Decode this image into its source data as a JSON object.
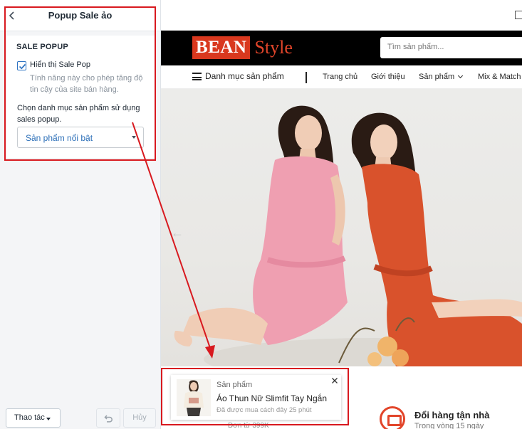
{
  "panel": {
    "title": "Popup Sale ảo",
    "section_title": "SALE POPUP",
    "checkbox_label": "Hiển thị Sale Pop",
    "checkbox_checked": true,
    "checkbox_help": "Tính năng này cho phép tăng độ tin cậy của site bán hàng.",
    "select_label": "Chọn danh mục sản phẩm sử dụng sales popup.",
    "select_value": "Sản phẩm nổi bật",
    "footer": {
      "actions_label": "Thao tác",
      "cancel_label": "Hủy"
    }
  },
  "site": {
    "logo_bean": "BEAN",
    "logo_style": "Style",
    "search_placeholder": "Tìm sản phẩm...",
    "nav": {
      "category": "Danh mục sản phẩm",
      "items": [
        "Trang chủ",
        "Giới thiệu",
        "Sản phẩm",
        "Mix & Match"
      ]
    },
    "features": {
      "left_sub": "Đơn từ 399K",
      "right_title": "Đổi hàng tận nhà",
      "right_sub": "Trong vòng 15 ngày"
    }
  },
  "popup": {
    "kicker": "Sản phẩm",
    "title": "Áo Thun Nữ Slimfit Tay Ngắn",
    "sub": "Đã được mua cách đây 25 phút"
  },
  "colors": {
    "annotation": "#d8191f",
    "brand": "#d9381e",
    "pink_dress": "#ef9fb1",
    "orange_dress": "#d9522c"
  }
}
